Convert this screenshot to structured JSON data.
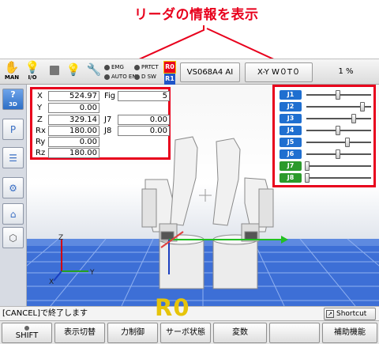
{
  "caption": "リーダの情報を表示",
  "toolbar": {
    "man_label": "MAN",
    "io_label": "I/O",
    "status": {
      "emg": "EMG",
      "prtct": "PRTCT",
      "auto_en": "AUTO EN",
      "dsw": "D SW"
    },
    "r0_badge": "R0",
    "r1_badge": "R1",
    "model_button": "VS068A4 AI",
    "frame_button": "X-Y W０T０",
    "speed": "1 %"
  },
  "coords": {
    "x": {
      "label": "X",
      "value": "524.97"
    },
    "y": {
      "label": "Y",
      "value": "0.00"
    },
    "z": {
      "label": "Z",
      "value": "329.14"
    },
    "rx": {
      "label": "Rx",
      "value": "180.00"
    },
    "ry": {
      "label": "Ry",
      "value": "0.00"
    },
    "rz": {
      "label": "Rz",
      "value": "180.00"
    },
    "fig": {
      "label": "Fig",
      "value": "5"
    },
    "j7": {
      "label": "J7",
      "value": "0.00"
    },
    "j8": {
      "label": "J8",
      "value": "0.00"
    }
  },
  "joints": [
    {
      "label": "J1",
      "level": 0.5,
      "color": "#1f6fd0"
    },
    {
      "label": "J2",
      "level": 0.9,
      "color": "#1f6fd0"
    },
    {
      "label": "J3",
      "level": 0.75,
      "color": "#1f6fd0"
    },
    {
      "label": "J4",
      "level": 0.5,
      "color": "#1f6fd0"
    },
    {
      "label": "J5",
      "level": 0.65,
      "color": "#1f6fd0"
    },
    {
      "label": "J6",
      "level": 0.5,
      "color": "#1f6fd0"
    },
    {
      "label": "J7",
      "level": 0.0,
      "color": "#2b9a2b"
    },
    {
      "label": "J8",
      "level": 0.0,
      "color": "#2b9a2b"
    }
  ],
  "sidebar": {
    "view3d_label": "3D"
  },
  "viewport": {
    "axis_x": "X",
    "axis_y": "Y",
    "axis_z": "Z"
  },
  "status_message": "[CANCEL]で終了します",
  "shortcut_label": "Shortcut",
  "overlay_label": "R0",
  "fkeys": {
    "shift": "SHIFT",
    "display_switch": "表示切替",
    "force_control": "力制御",
    "servo_state": "サーボ状態",
    "variables": "変数",
    "blank": "",
    "aux": "補助機能"
  },
  "colors": {
    "highlight": "#e8001c",
    "viewport_floor": "#3d6fd6",
    "overlay_text": "#e6c40a",
    "joint_blue": "#1f6fd0",
    "joint_green": "#2b9a2b"
  }
}
